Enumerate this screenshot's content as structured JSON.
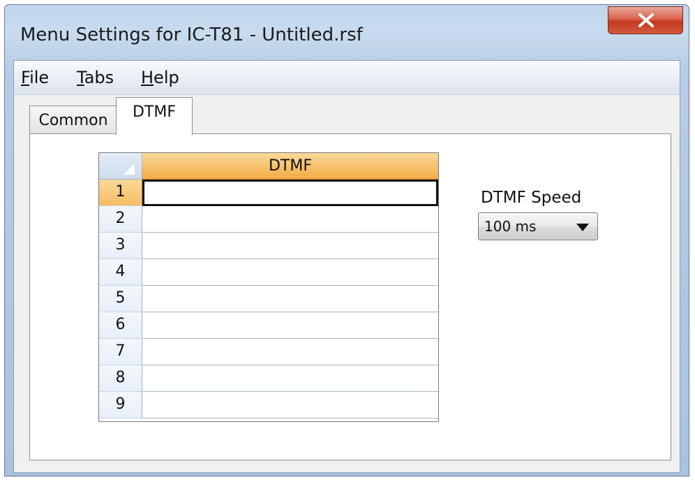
{
  "window": {
    "title": "Menu Settings for IC-T81 - Untitled.rsf"
  },
  "menubar": {
    "items": [
      {
        "label": "File",
        "mnemonic": "F",
        "rest": "ile"
      },
      {
        "label": "Tabs",
        "mnemonic": "T",
        "rest": "abs"
      },
      {
        "label": "Help",
        "mnemonic": "H",
        "rest": "elp"
      }
    ]
  },
  "tabs": [
    {
      "label": "Common",
      "selected": false
    },
    {
      "label": "DTMF",
      "selected": true
    }
  ],
  "grid": {
    "column_header": "DTMF",
    "rows": [
      {
        "index": "1",
        "value": ""
      },
      {
        "index": "2",
        "value": ""
      },
      {
        "index": "3",
        "value": ""
      },
      {
        "index": "4",
        "value": ""
      },
      {
        "index": "5",
        "value": ""
      },
      {
        "index": "6",
        "value": ""
      },
      {
        "index": "7",
        "value": ""
      },
      {
        "index": "8",
        "value": ""
      },
      {
        "index": "9",
        "value": ""
      }
    ],
    "selected_row": "1"
  },
  "dtmf_speed": {
    "label": "DTMF Speed",
    "value": "100 ms"
  },
  "icons": {
    "close": "close-icon",
    "dropdown": "chevron-down-icon",
    "corner": "select-all-corner-icon"
  },
  "colors": {
    "close_button": "#c1391f",
    "header_orange": "#f7c16a",
    "row_header_blue": "#e6eef8"
  }
}
